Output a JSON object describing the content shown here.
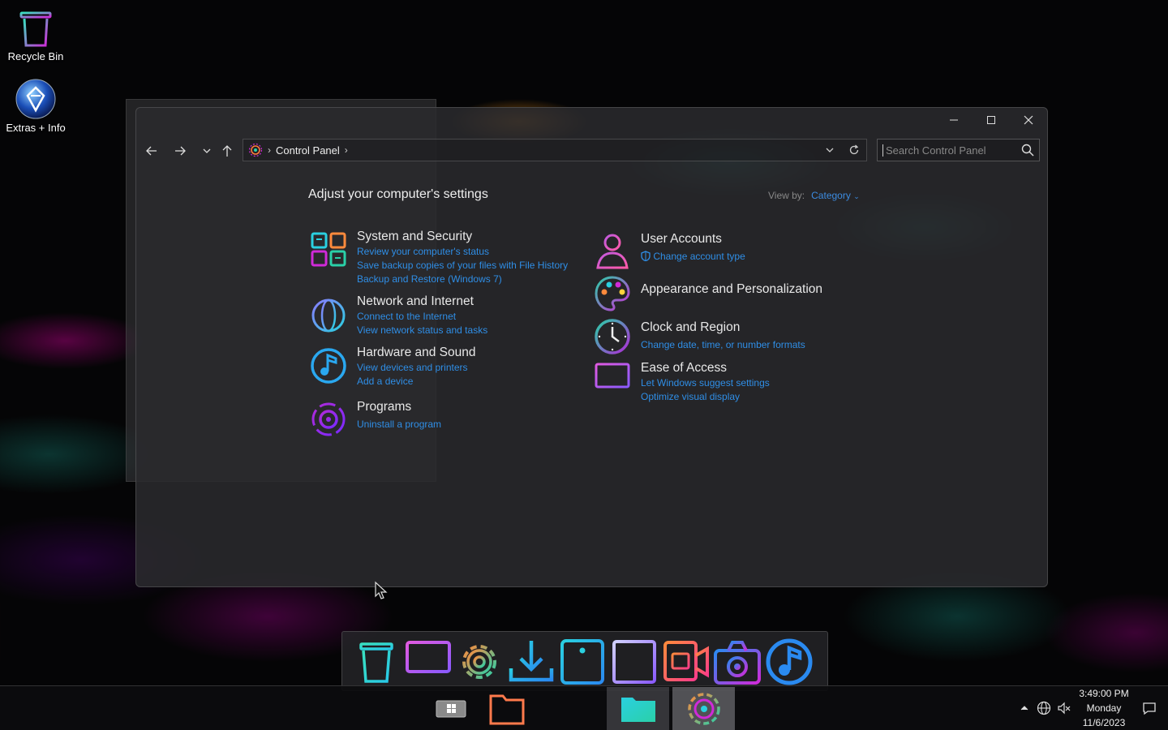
{
  "desktop": {
    "icons": [
      {
        "label": "Recycle Bin",
        "icon": "recycle-bin-icon"
      },
      {
        "label": "Extras + Info",
        "icon": "extras-info-icon"
      }
    ]
  },
  "window": {
    "caption": {
      "minimize": "minimize-icon",
      "maximize": "maximize-icon",
      "close": "close-icon"
    },
    "nav": {
      "back": "back-icon",
      "forward": "forward-icon",
      "recent": "chevron-down-icon",
      "up": "up-icon"
    },
    "address": {
      "crumb": "Control Panel",
      "icon": "control-panel-icon"
    },
    "search": {
      "placeholder": "Search Control Panel"
    },
    "heading": "Adjust your computer's settings",
    "view_by": {
      "label": "View by:",
      "value": "Category"
    },
    "categories_left": [
      {
        "title": "System and Security",
        "icon": "system-security-icon",
        "links": [
          "Review your computer's status",
          "Save backup copies of your files with File History",
          "Backup and Restore (Windows 7)"
        ]
      },
      {
        "title": "Network and Internet",
        "icon": "globe-icon",
        "links": [
          "Connect to the Internet",
          "View network status and tasks"
        ]
      },
      {
        "title": "Hardware and Sound",
        "icon": "music-note-icon",
        "links": [
          "View devices and printers",
          "Add a device"
        ]
      },
      {
        "title": "Programs",
        "icon": "programs-icon",
        "links": [
          "Uninstall a program"
        ]
      }
    ],
    "categories_right": [
      {
        "title": "User Accounts",
        "icon": "user-icon",
        "links": [
          "Change account type"
        ]
      },
      {
        "title": "Appearance and Personalization",
        "icon": "palette-icon",
        "links": []
      },
      {
        "title": "Clock and Region",
        "icon": "clock-icon",
        "links": [
          "Change date, time, or number formats"
        ]
      },
      {
        "title": "Ease of Access",
        "icon": "monitor-icon",
        "links": [
          "Let Windows suggest settings",
          "Optimize visual display"
        ]
      }
    ]
  },
  "dock": {
    "items": [
      "recycle-bin-icon",
      "computer-icon",
      "settings-gear-icon",
      "download-icon",
      "info-icon",
      "document-icon",
      "video-icon",
      "camera-icon",
      "music-icon"
    ]
  },
  "taskbar": {
    "items": [
      "start-icon",
      "file-explorer-icon",
      "folder-app-icon",
      "control-panel-icon"
    ],
    "tray": [
      "chevron-up-icon",
      "network-icon",
      "volume-icon",
      "notification-icon"
    ],
    "clock": {
      "time": "3:49:00 PM",
      "day": "Monday",
      "date": "11/6/2023"
    }
  },
  "colors": {
    "accent_link": "#2f8ee6",
    "neon_cyan": "#28c8e8",
    "neon_magenta": "#d02ad8",
    "neon_orange": "#ff8a3c",
    "neon_teal": "#2ad0a8"
  }
}
